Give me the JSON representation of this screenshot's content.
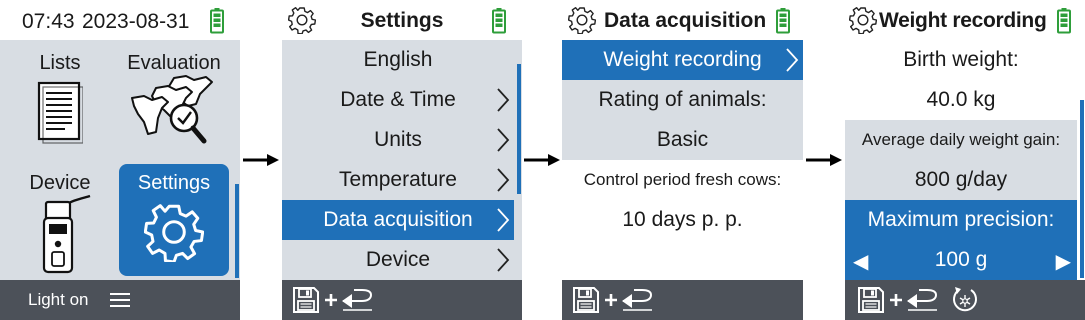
{
  "screen1": {
    "header": {
      "time": "07:43",
      "date": "2023-08-31"
    },
    "tiles": {
      "lists": "Lists",
      "evaluation": "Evaluation",
      "device": "Device",
      "settings": "Settings"
    },
    "footer": {
      "light": "Light on"
    }
  },
  "screen2": {
    "title": "Settings",
    "items": [
      "English",
      "Date & Time",
      "Units",
      "Temperature",
      "Data acquisition",
      "Device"
    ],
    "selected": "Data acquisition"
  },
  "screen3": {
    "title": "Data acquisition",
    "selected_item": "Weight recording",
    "rating_label": "Rating of animals:",
    "rating_value": "Basic",
    "control_label": "Control period fresh cows:",
    "control_value": "10 days p. p."
  },
  "screen4": {
    "title": "Weight recording",
    "birth_label": "Birth weight:",
    "birth_value": "40.0 kg",
    "adg_label": "Average daily weight gain:",
    "adg_value": "800 g/day",
    "precision_label": "Maximum precision:",
    "precision_value": "100 g",
    "left_arrow": "◀",
    "right_arrow": "▶"
  },
  "colors": {
    "accent": "#1f70b8",
    "battery": "#2e9e3a",
    "footer": "#4c5159",
    "panel": "#d8dde3"
  },
  "icons": [
    "battery-icon",
    "gear-icon",
    "list-icon",
    "evaluation-icon",
    "handheld-device-icon",
    "menu-icon",
    "save-icon",
    "plus-icon",
    "back-icon",
    "reset-icon",
    "chevron-right-icon",
    "flow-arrow-icon"
  ]
}
